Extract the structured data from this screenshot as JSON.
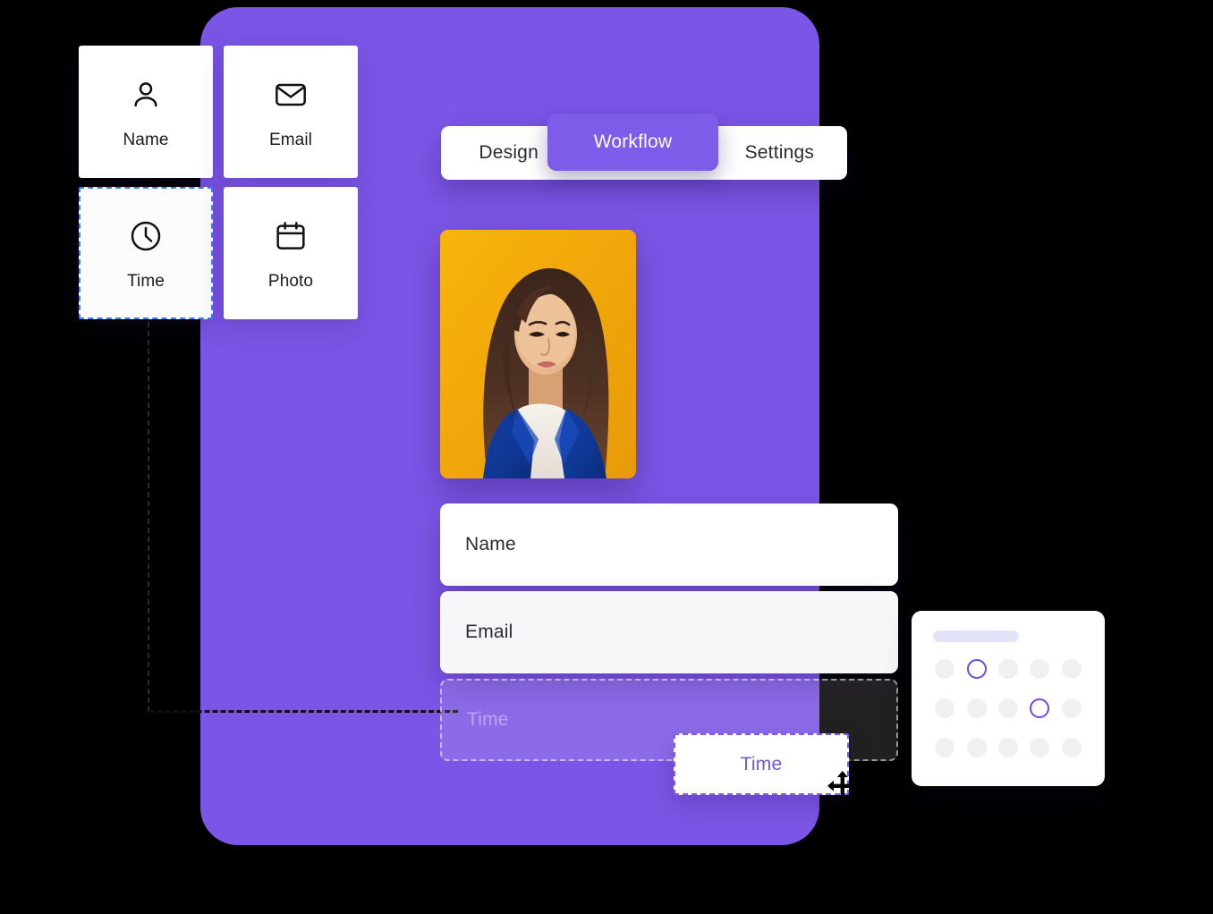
{
  "palette": {
    "cards": [
      {
        "label": "Name",
        "icon": "user-icon",
        "selected": false
      },
      {
        "label": "Email",
        "icon": "envelope-icon",
        "selected": false
      },
      {
        "label": "Time",
        "icon": "clock-icon",
        "selected": true
      },
      {
        "label": "Photo",
        "icon": "calendar-icon",
        "selected": false
      }
    ]
  },
  "tabs": {
    "items": [
      {
        "label": "Design",
        "active": false
      },
      {
        "label": "Workflow",
        "active": true
      },
      {
        "label": "Settings",
        "active": false
      }
    ],
    "active_label": "Workflow"
  },
  "preview": {
    "photo_alt": "portrait-photo",
    "fields": [
      {
        "label": "Name",
        "state": "filled"
      },
      {
        "label": "Email",
        "state": "filled"
      },
      {
        "label": "Time",
        "state": "drop-target"
      }
    ]
  },
  "drag": {
    "chip_label": "Time",
    "cursor": "move-cursor"
  },
  "picker": {
    "header_placeholder": "",
    "rows": [
      [
        "empty",
        "selected",
        "empty",
        "empty",
        "empty"
      ],
      [
        "empty",
        "empty",
        "empty",
        "selected",
        "empty"
      ],
      [
        "empty",
        "empty",
        "empty",
        "empty",
        "empty"
      ]
    ]
  },
  "colors": {
    "brand_purple": "#7B55E6",
    "tab_active_purple": "#7C5CE8",
    "selection_blue": "#3C7CE8",
    "chip_text_purple": "#6F55E0",
    "picker_bar": "#E4E4F8",
    "photo_background_orange": "#F2A80B",
    "photo_blazer_blue": "#11419B"
  }
}
